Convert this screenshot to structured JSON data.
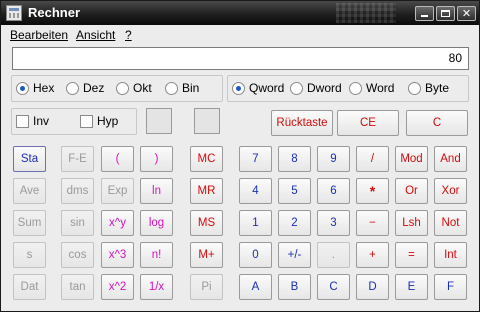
{
  "window": {
    "title": "Rechner"
  },
  "menu": [
    "Bearbeiten",
    "Ansicht",
    "?"
  ],
  "display": {
    "value": "80"
  },
  "base_group": [
    {
      "label": "Hex",
      "selected": true
    },
    {
      "label": "Dez",
      "selected": false
    },
    {
      "label": "Okt",
      "selected": false
    },
    {
      "label": "Bin",
      "selected": false
    }
  ],
  "word_group": [
    {
      "label": "Qword",
      "selected": true
    },
    {
      "label": "Dword",
      "selected": false
    },
    {
      "label": "Word",
      "selected": false
    },
    {
      "label": "Byte",
      "selected": false
    }
  ],
  "options": [
    {
      "label": "Inv",
      "checked": false
    },
    {
      "label": "Hyp",
      "checked": false
    }
  ],
  "edit_buttons": [
    "Rücktaste",
    "CE",
    "C"
  ],
  "stat_buttons": [
    "Sta",
    "Ave",
    "Sum",
    "s",
    "Dat"
  ],
  "sci_col1": [
    "F-E",
    "dms",
    "sin",
    "cos",
    "tan"
  ],
  "sci_col2": [
    "(",
    "Exp",
    "x^y",
    "x^3",
    "x^2"
  ],
  "sci_col3": [
    ")",
    "ln",
    "log",
    "n!",
    "1/x"
  ],
  "memory_buttons": [
    "MC",
    "MR",
    "MS",
    "M+",
    "Pi"
  ],
  "digit_rows": [
    [
      "7",
      "8",
      "9",
      "/",
      "Mod",
      "And"
    ],
    [
      "4",
      "5",
      "6",
      "*",
      "Or",
      "Xor"
    ],
    [
      "1",
      "2",
      "3",
      "−",
      "Lsh",
      "Not"
    ],
    [
      "0",
      "+/-",
      ".",
      "+",
      "=",
      "Int"
    ],
    [
      "A",
      "B",
      "C",
      "D",
      "E",
      "F"
    ]
  ],
  "colors": {
    "digit_text": "#1b2fb5",
    "operator_text": "#d00c0c",
    "function_text": "#d113c1",
    "disabled_text": "#9a9a9a"
  }
}
